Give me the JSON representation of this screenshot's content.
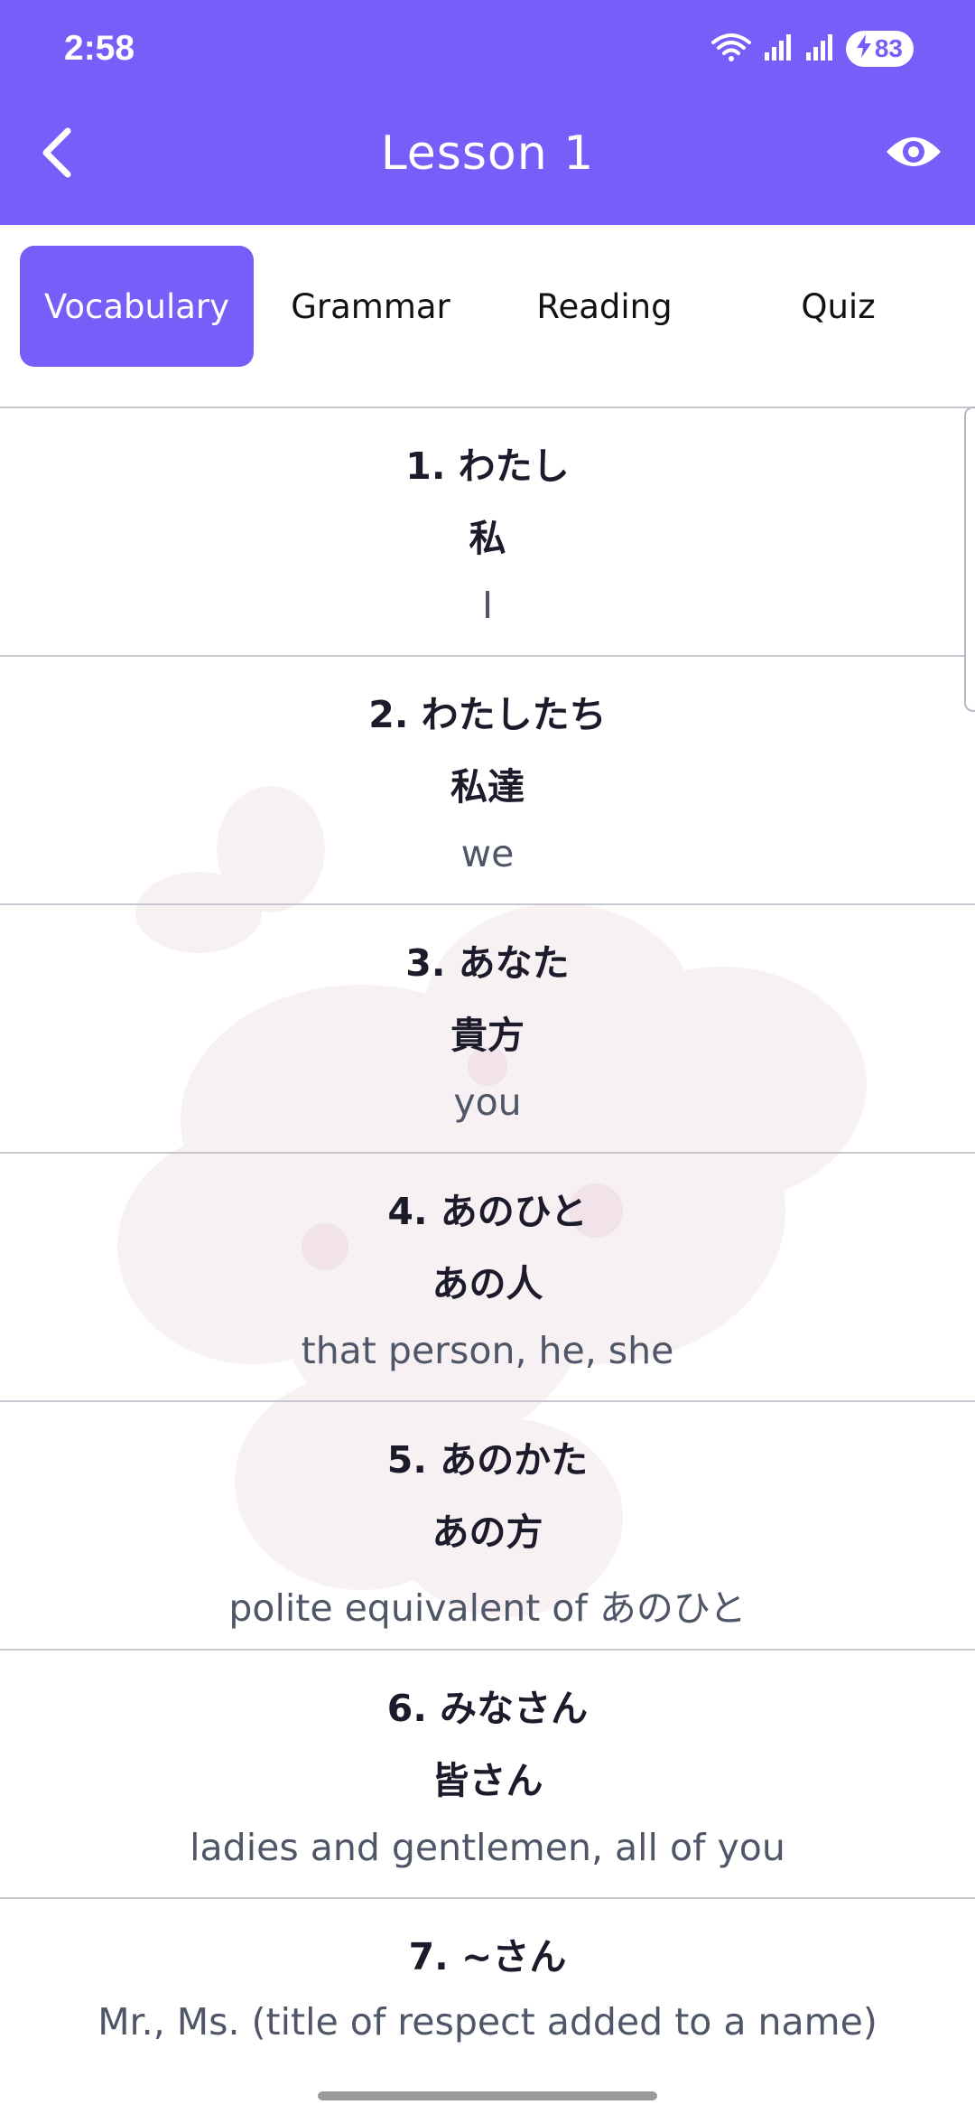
{
  "status": {
    "time": "2:58",
    "battery": "83"
  },
  "header": {
    "title": "Lesson 1",
    "back_icon": "chevron-left-icon",
    "eye_icon": "eye-icon",
    "color": "#765ff8"
  },
  "tabs": [
    {
      "label": "Vocabulary",
      "active": true
    },
    {
      "label": "Grammar",
      "active": false
    },
    {
      "label": "Reading",
      "active": false
    },
    {
      "label": "Quiz",
      "active": false
    }
  ],
  "vocab": [
    {
      "word": "1. わたし",
      "kanji": "私",
      "meaning": "I"
    },
    {
      "word": "2. わたしたち",
      "kanji": "私達",
      "meaning": "we"
    },
    {
      "word": "3. あなた",
      "kanji": "貴方",
      "meaning": "you"
    },
    {
      "word": "4. あのひと",
      "kanji": "あの人",
      "meaning": "that person, he, she"
    },
    {
      "word": "5. あのかた",
      "kanji": "あの方",
      "meaning": "polite equivalent of あのひと"
    },
    {
      "word": "6. みなさん",
      "kanji": "皆さん",
      "meaning": "ladies and gentlemen, all of you"
    },
    {
      "word": "7. ~さん",
      "kanji": "",
      "meaning": "Mr., Ms. (title of respect added to a name)"
    }
  ]
}
